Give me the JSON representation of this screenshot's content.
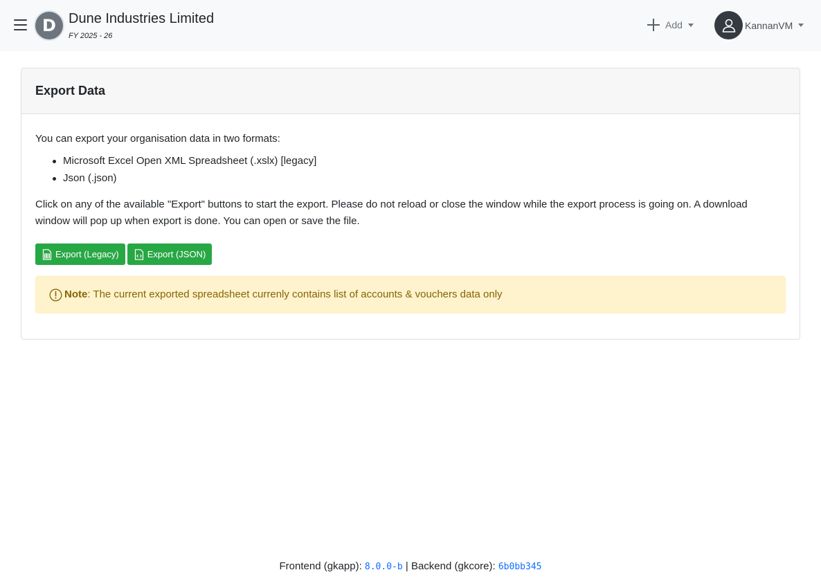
{
  "navbar": {
    "org_initial": "D",
    "org_name": "Dune Industries Limited",
    "fiscal_year": "FY 2025 - 26",
    "add_label": "Add",
    "user_name": "KannanVM"
  },
  "card": {
    "title": "Export Data",
    "intro": "You can export your organisation data in two formats:",
    "formats": [
      "Microsoft Excel Open XML Spreadsheet (.xslx) [legacy]",
      "Json (.json)"
    ],
    "instructions": "Click on any of the available \"Export\" buttons to start the export. Please do not reload or close the window while the export process is going on. A download window will pop up when export is done. You can open or save the file.",
    "buttons": {
      "export_legacy": "Export (Legacy)",
      "export_json": "Export (JSON)"
    },
    "alert": {
      "label": "Note",
      "text": ": The current exported spreadsheet currenly contains list of accounts & vouchers data only"
    }
  },
  "footer": {
    "frontend_label": "Frontend (gkapp):",
    "frontend_version": "8.0.0-b",
    "separator": "|",
    "backend_label": "Backend (gkcore):",
    "backend_version": "6b0bb345"
  },
  "colors": {
    "navbar_bg": "#f8f9fa",
    "button_green": "#28a745",
    "alert_bg": "#fff3cd",
    "alert_text": "#856404",
    "version_blue": "#0d6efd"
  },
  "icons": {
    "menu": "hamburger-icon",
    "add": "plus-icon",
    "user": "user-icon",
    "legacy": "spreadsheet-file-icon",
    "json": "code-file-icon",
    "alert": "exclamation-circle-icon"
  }
}
